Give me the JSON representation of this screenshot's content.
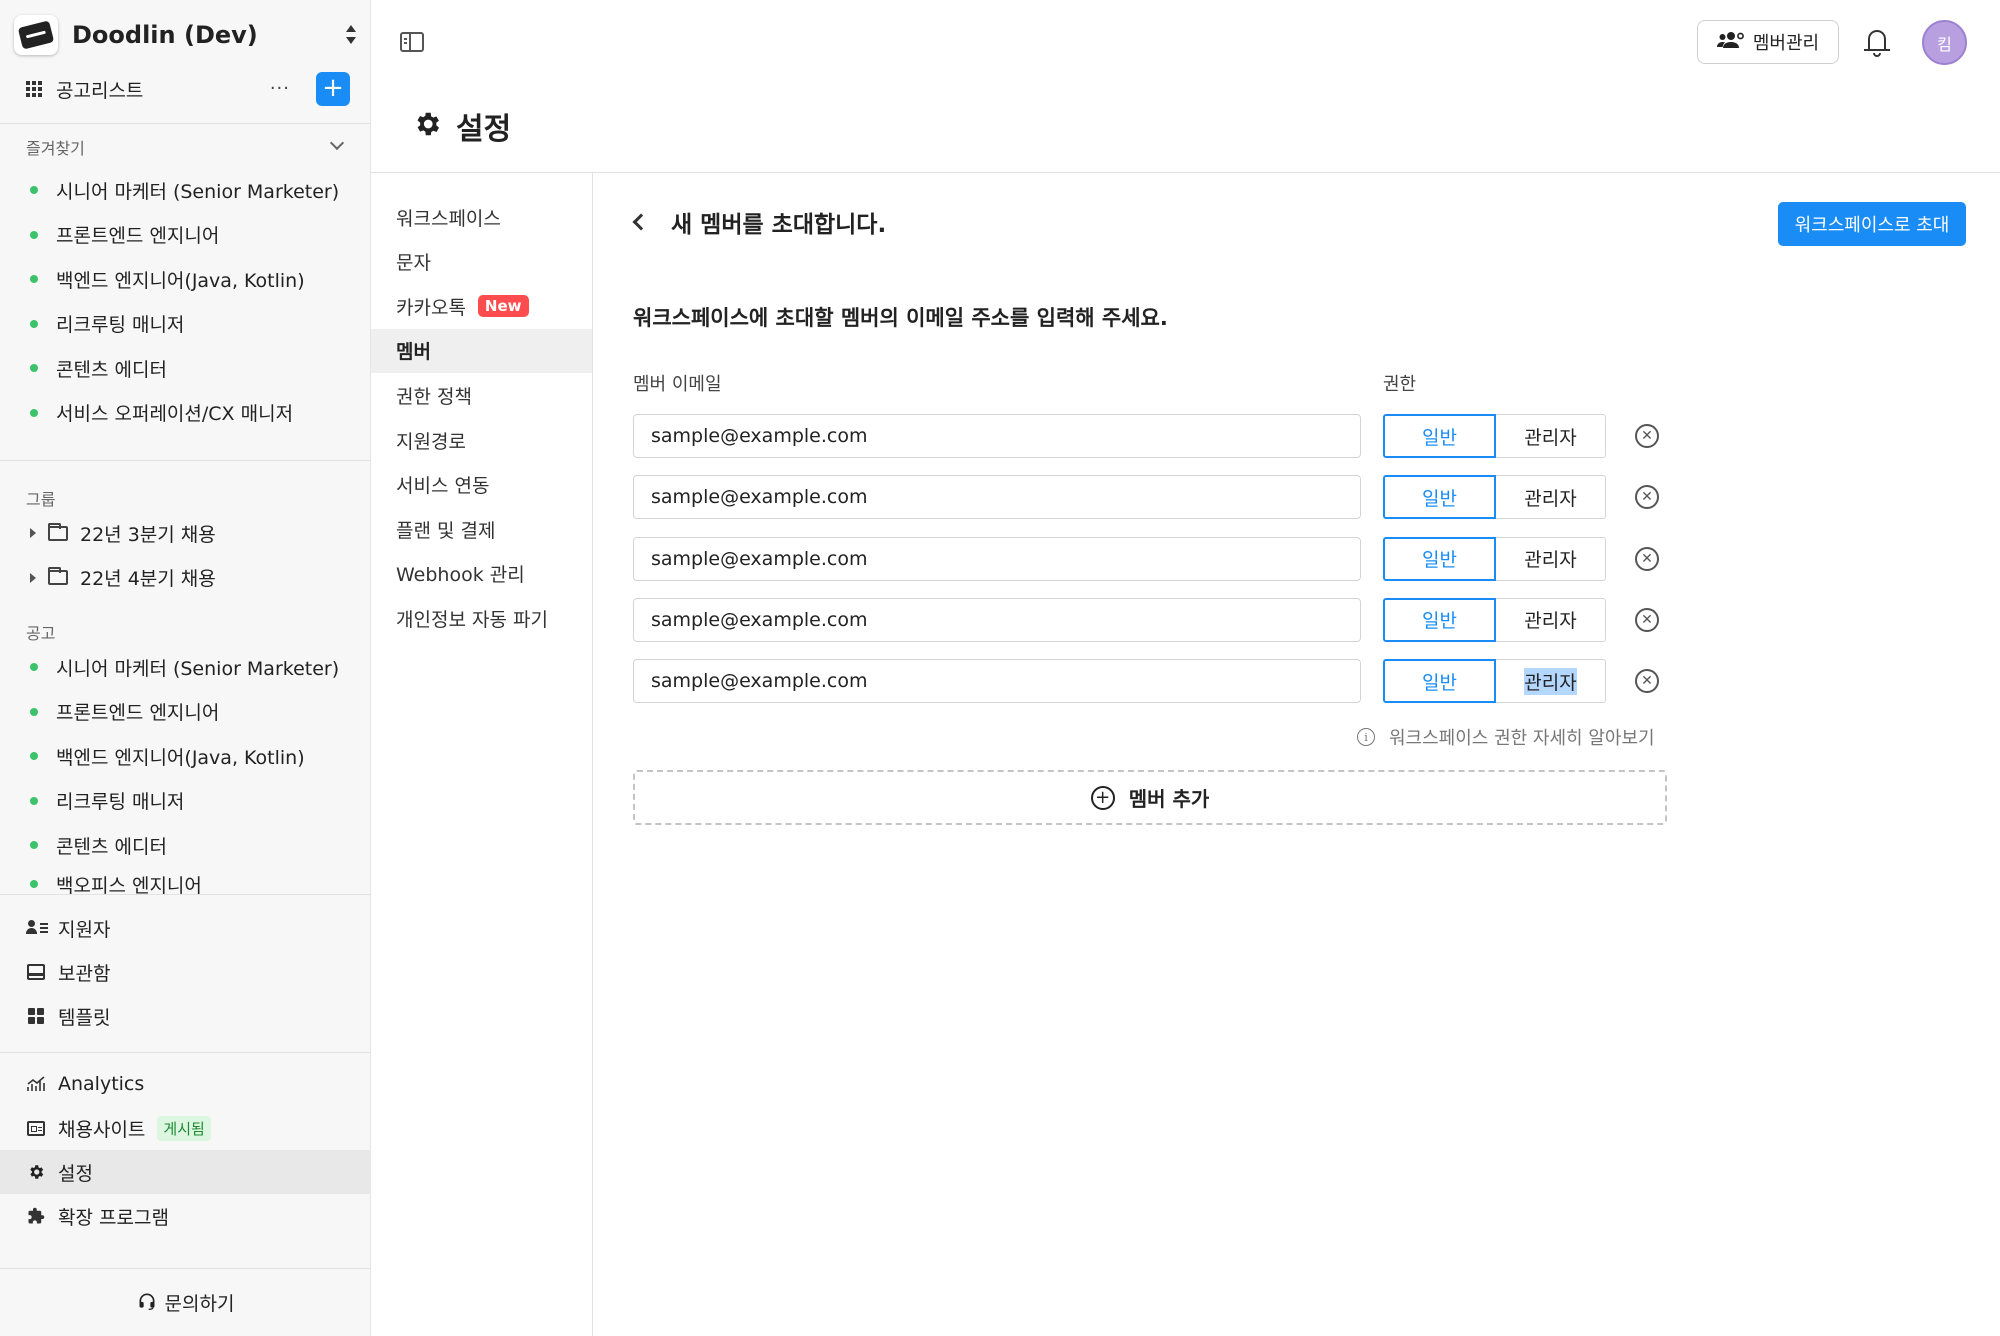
{
  "workspace": {
    "name": "Doodlin (Dev)"
  },
  "sidebar": {
    "jobs_label": "공고리스트",
    "more_label": "···",
    "add_label": "+",
    "favorites_label": "즐겨찾기",
    "favorites": [
      "시니어 마케터 (Senior Marketer)",
      "프론트엔드 엔지니어",
      "백엔드 엔지니어(Java, Kotlin)",
      "리크루팅 매니저",
      "콘텐츠 에디터",
      "서비스 오퍼레이션/CX 매니저"
    ],
    "groups_label": "그룹",
    "groups": [
      "22년 3분기 채용",
      "22년 4분기 채용"
    ],
    "postings_label": "공고",
    "postings": [
      "시니어 마케터 (Senior Marketer)",
      "프론트엔드 엔지니어",
      "백엔드 엔지니어(Java, Kotlin)",
      "리크루팅 매니저",
      "콘텐츠 에디터",
      "백오피스 엔지니어"
    ],
    "bottom": {
      "applicants": "지원자",
      "archive": "보관함",
      "templates": "템플릿",
      "analytics": "Analytics",
      "career_site": "채용사이트",
      "career_site_badge": "게시됨",
      "settings": "설정",
      "extensions": "확장 프로그램"
    },
    "inquiry": "문의하기"
  },
  "header": {
    "member_manage": "멤버관리",
    "avatar_initial": "킴"
  },
  "page": {
    "title": "설정"
  },
  "settings_nav": [
    {
      "label": "워크스페이스"
    },
    {
      "label": "문자"
    },
    {
      "label": "카카오톡",
      "badge": "New"
    },
    {
      "label": "멤버",
      "active": true
    },
    {
      "label": "권한 정책"
    },
    {
      "label": "지원경로"
    },
    {
      "label": "서비스 연동"
    },
    {
      "label": "플랜 및 결제"
    },
    {
      "label": "Webhook 관리"
    },
    {
      "label": "개인정보 자동 파기"
    }
  ],
  "invite": {
    "title": "새 멤버를 초대합니다.",
    "invite_button": "워크스페이스로 초대",
    "instructions": "워크스페이스에 초대할 멤버의 이메일 주소를 입력해 주세요.",
    "email_column": "멤버 이메일",
    "role_column": "권한",
    "role_general": "일반",
    "role_admin": "관리자",
    "rows": [
      {
        "email": "sample@example.com",
        "role": "일반"
      },
      {
        "email": "sample@example.com",
        "role": "일반"
      },
      {
        "email": "sample@example.com",
        "role": "일반"
      },
      {
        "email": "sample@example.com",
        "role": "일반"
      },
      {
        "email": "sample@example.com",
        "role": "일반"
      }
    ],
    "help_link": "워크스페이스 권한 자세히 알아보기",
    "add_member": "멤버 추가"
  }
}
